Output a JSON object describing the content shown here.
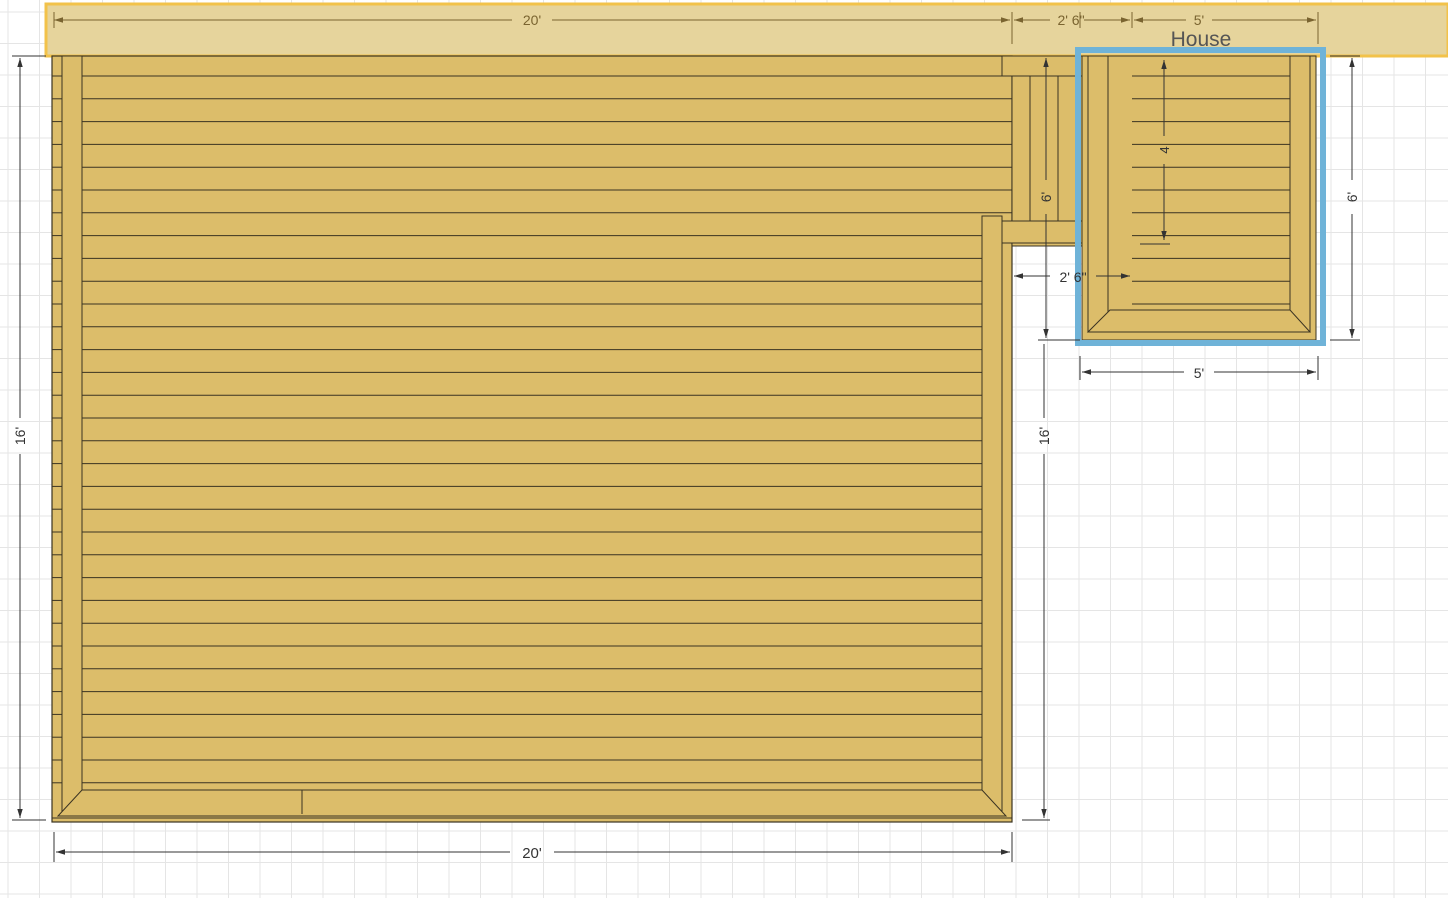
{
  "house": {
    "label": "House"
  },
  "dimensions": {
    "top_main_width": "20'",
    "top_gap_width": "2' 6\"",
    "top_small_width": "5'",
    "bottom_main_width": "20'",
    "small_deck_width": "5'",
    "left_height": "16'",
    "right_height": "16'",
    "step_height": "6'",
    "small_deck_height": "6'",
    "inner_step_depth": "4",
    "step_run": "2' 6\""
  },
  "colors": {
    "house": "#e6d49c",
    "house_outline": "#f2c24a",
    "deck": "#dcbd6a",
    "board_line": "#3a3322",
    "selection": "#6fb3d8",
    "grid": "#e3e3e3",
    "dim_line": "#444444",
    "dim_line_top": "#8a7440"
  }
}
